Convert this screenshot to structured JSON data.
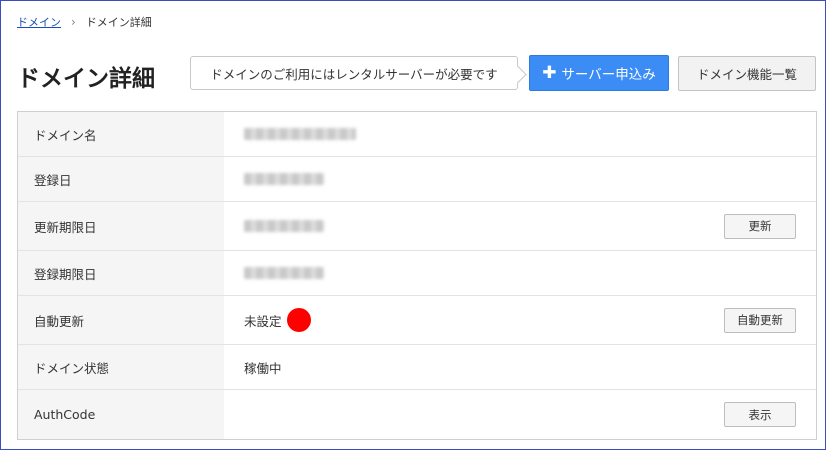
{
  "breadcrumb": {
    "link": "ドメイン",
    "separator": "›",
    "current": "ドメイン詳細"
  },
  "page_title": "ドメイン詳細",
  "tooltip": "ドメインのご利用にはレンタルサーバーが必要です",
  "buttons": {
    "server_apply": "サーバー申込み",
    "domain_features": "ドメイン機能一覧"
  },
  "rows": [
    {
      "label": "ドメイン名",
      "value": ""
    },
    {
      "label": "登録日",
      "value": ""
    },
    {
      "label": "更新期限日",
      "value": "",
      "button": "更新"
    },
    {
      "label": "登録期限日",
      "value": ""
    },
    {
      "label": "自動更新",
      "value": "未設定",
      "button": "自動更新"
    },
    {
      "label": "ドメイン状態",
      "value": "稼働中"
    },
    {
      "label": "AuthCode",
      "value": "",
      "button": "表示"
    }
  ],
  "colors": {
    "primary": "#3b8cf5",
    "status_dot": "#ff0000"
  }
}
